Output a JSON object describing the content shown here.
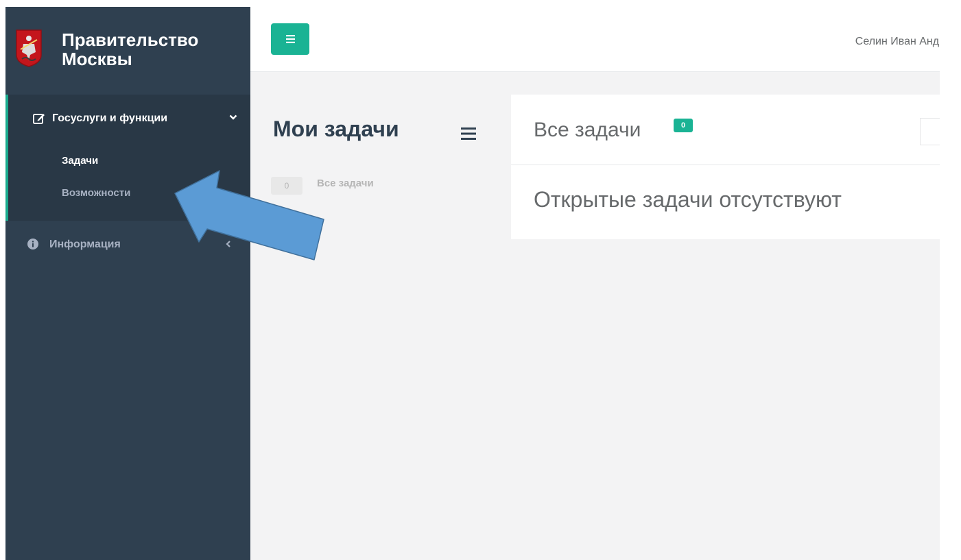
{
  "brand": {
    "title": "Правительство Москвы"
  },
  "sidebar": {
    "section": {
      "label": "Госуслуги и функции",
      "items": [
        {
          "label": "Задачи"
        },
        {
          "label": "Возможности"
        }
      ]
    },
    "info": {
      "label": "Информация"
    }
  },
  "topbar": {
    "user_name": "Селин Иван Андр"
  },
  "page": {
    "title": "Мои задачи",
    "filters": [
      {
        "count": "0",
        "label": "Все задачи"
      }
    ]
  },
  "panel": {
    "title": "Все задачи",
    "count": "0",
    "empty_message": "Открытые задачи отсутствуют"
  },
  "colors": {
    "sidebar": "#2f4050",
    "sidebar_active": "#293846",
    "accent": "#1ab394",
    "arrow_fill": "#5b9bd5",
    "arrow_stroke": "#41719c"
  },
  "icons": [
    "moscow-coat-of-arms-icon",
    "edit-icon",
    "chevron-down-icon",
    "info-icon",
    "chevron-left-icon",
    "bars-icon"
  ]
}
